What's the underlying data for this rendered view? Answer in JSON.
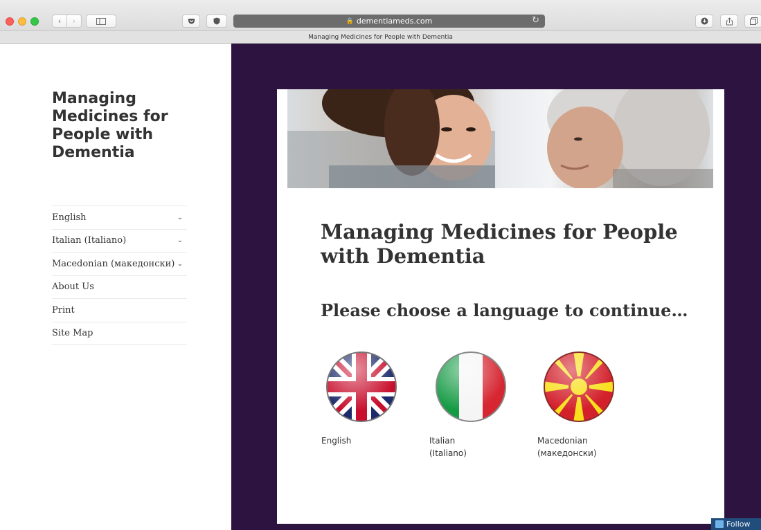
{
  "browser": {
    "url": "dementiameds.com",
    "tab_title": "Managing Medicines for People with Dementia"
  },
  "sidebar": {
    "site_title": "Managing Medicines for People with Dementia",
    "nav": [
      {
        "label": "English",
        "has_submenu": true
      },
      {
        "label": "Italian (Italiano)",
        "has_submenu": true
      },
      {
        "label": "Macedonian (македонски)",
        "has_submenu": true
      },
      {
        "label": "About Us",
        "has_submenu": false
      },
      {
        "label": "Print",
        "has_submenu": false
      },
      {
        "label": "Site Map",
        "has_submenu": false
      }
    ]
  },
  "main": {
    "title": "Managing Medicines for People with Dementia",
    "subtitle": "Please choose a language to continue…",
    "languages": [
      {
        "label": "English",
        "flag": "uk-flag-icon"
      },
      {
        "label": "Italian (Italiano)",
        "flag": "italy-flag-icon"
      },
      {
        "label": "Macedonian (македонски)",
        "flag": "macedonia-flag-icon"
      }
    ]
  },
  "follow_button": {
    "label": "Follow"
  },
  "colors": {
    "sidebar_bg": "#ffffff",
    "main_bg": "#2c1340",
    "text": "#333333",
    "follow_bg": "#214d7c"
  }
}
